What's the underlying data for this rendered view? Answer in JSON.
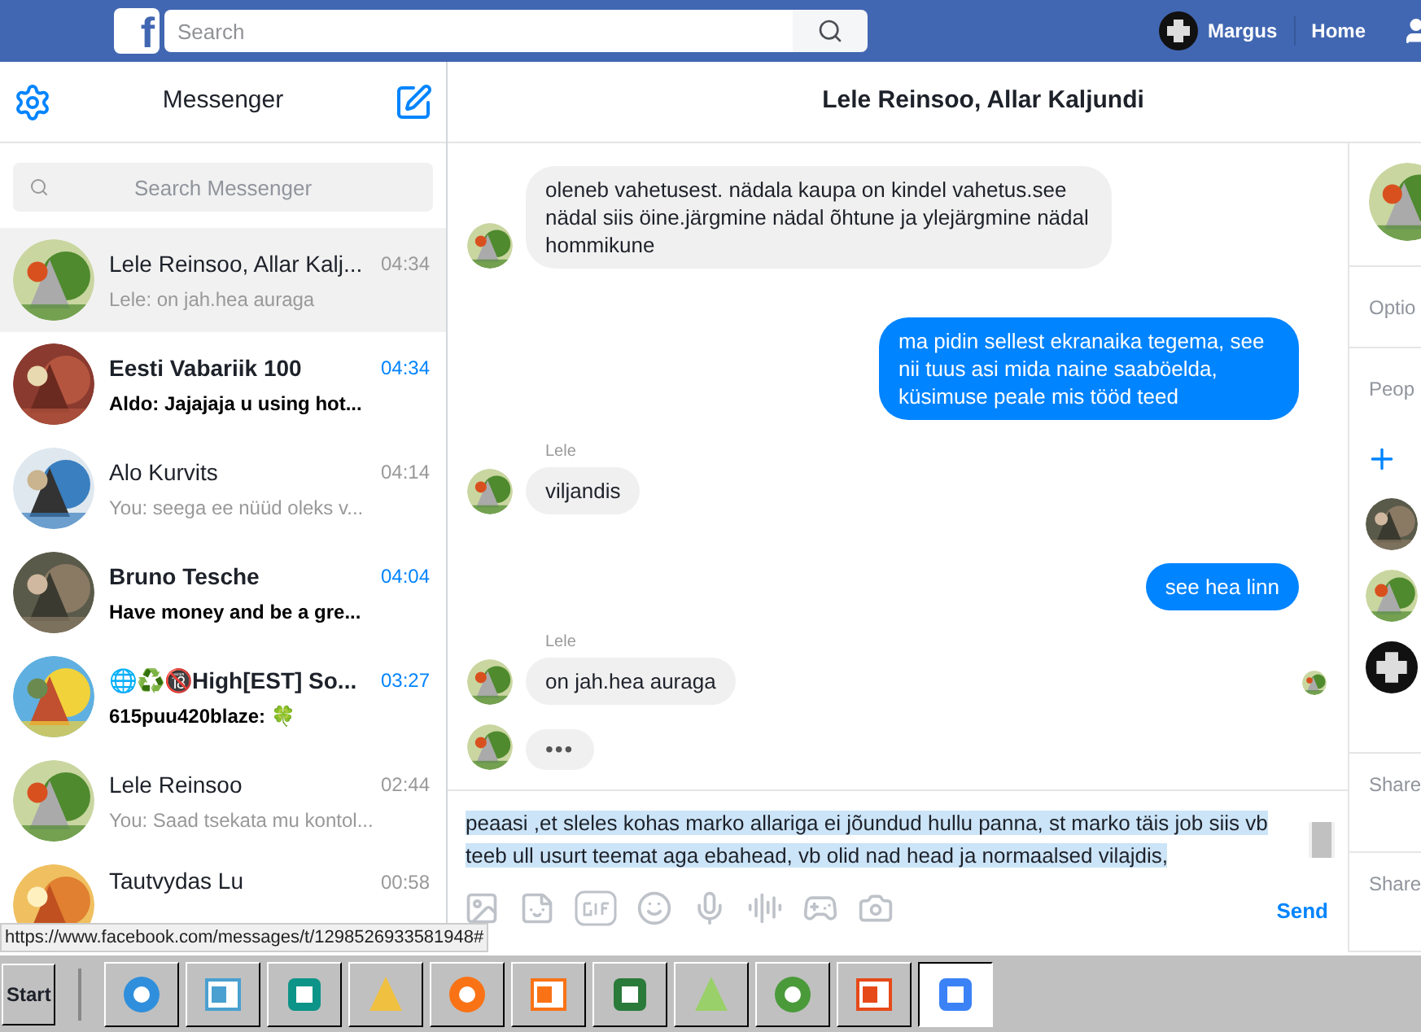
{
  "topbar": {
    "logo": "f",
    "search": {
      "placeholder": "Search"
    },
    "user": "Margus",
    "home": "Home"
  },
  "sidebar": {
    "title": "Messenger",
    "search": {
      "placeholder": "Search Messenger"
    },
    "conversations": [
      {
        "name": "Lele Reinsoo, Allar Kalj...",
        "snippet": "Lele: on jah.hea auraga",
        "time": "04:34",
        "unread": false,
        "selected": true
      },
      {
        "name": "Eesti Vabariik 100",
        "snippet": "Aldo: Jajajaja u using hot...",
        "time": "04:34",
        "unread": true,
        "selected": false
      },
      {
        "name": "Alo Kurvits",
        "snippet": "You: seega ee nüüd oleks v...",
        "time": "04:14",
        "unread": false,
        "selected": false
      },
      {
        "name": "Bruno Tesche",
        "snippet": "Have money and be a gre...",
        "time": "04:04",
        "unread": true,
        "selected": false
      },
      {
        "name": "🌐♻️🔞High[EST] So...",
        "snippet": "615puu420blaze: 🍀",
        "time": "03:27",
        "unread": true,
        "selected": false
      },
      {
        "name": "Lele Reinsoo",
        "snippet": "You: Saad tsekata mu kontol...",
        "time": "02:44",
        "unread": false,
        "selected": false
      },
      {
        "name": "Tautvydas Lu",
        "time": "00:58",
        "unread": false,
        "selected": false
      }
    ]
  },
  "chat": {
    "title": "Lele Reinsoo, Allar Kaljundi",
    "messages": [
      {
        "kind": "incoming",
        "text": "oleneb vahetusest. nädala kaupa on kindel vahetus.see nädal siis öine.järgmine nädal õhtune ja ylejärgmine nädal hommikune"
      },
      {
        "kind": "outgoing",
        "text": "ma pidin sellest ekranaika tegema, see nii tuus asi mida naine saaböelda, küsimuse peale mis tööd teed"
      },
      {
        "kind": "incoming",
        "sender": "Lele",
        "text": "viljandis"
      },
      {
        "kind": "outgoing",
        "text": "see hea linn"
      },
      {
        "kind": "incoming",
        "sender": "Lele",
        "text": "on jah.hea auraga",
        "seen": true
      },
      {
        "kind": "typing",
        "text": "•••"
      }
    ],
    "composer": {
      "value": "peaasi ,et sleles kohas marko allariga ei jõundud hullu panna, st marko täis job siis vb teeb ull usurt teemat aga ebahead, vb olid nad head ja normaalsed vilajdis,",
      "send": "Send"
    }
  },
  "details": {
    "labels": [
      "Optio",
      "Peop"
    ],
    "shared": [
      "Share",
      "Share"
    ]
  },
  "status_url": "https://www.facebook.com/messages/t/1298526933581948#",
  "taskbar": {
    "start": "Start",
    "apps": [
      {
        "selected": false
      },
      {
        "selected": false
      },
      {
        "selected": false
      },
      {
        "selected": false
      },
      {
        "selected": false
      },
      {
        "selected": false
      },
      {
        "selected": false
      },
      {
        "selected": false
      },
      {
        "selected": false
      },
      {
        "selected": false
      },
      {
        "selected": true
      }
    ]
  }
}
